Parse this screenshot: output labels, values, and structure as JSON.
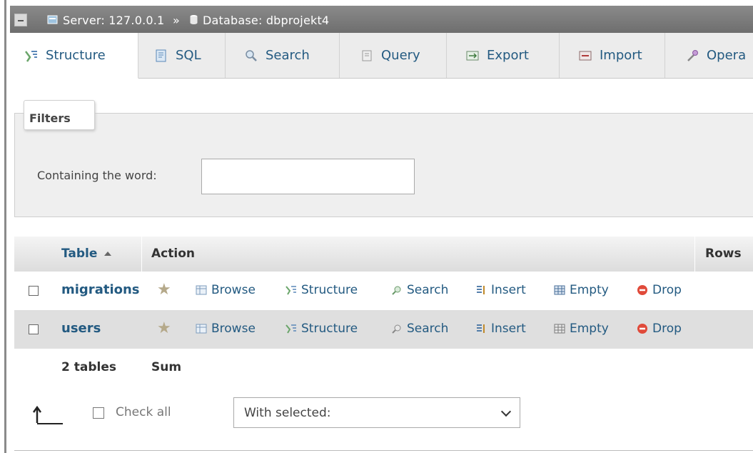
{
  "breadcrumb": {
    "server": "Server: 127.0.0.1",
    "separator": "»",
    "database": "Database: dbprojekt4"
  },
  "tabs": [
    {
      "label": "Structure",
      "icon": "structure-icon",
      "active": true
    },
    {
      "label": "SQL",
      "icon": "sql-icon"
    },
    {
      "label": "Search",
      "icon": "search-icon"
    },
    {
      "label": "Query",
      "icon": "query-icon"
    },
    {
      "label": "Export",
      "icon": "export-icon"
    },
    {
      "label": "Import",
      "icon": "import-icon"
    },
    {
      "label": "Opera",
      "icon": "wrench-icon"
    }
  ],
  "filters": {
    "legend": "Filters",
    "label": "Containing the word:",
    "value": ""
  },
  "table": {
    "headers": {
      "table": "Table",
      "action": "Action",
      "rows": "Rows"
    },
    "actions": [
      "Browse",
      "Structure",
      "Search",
      "Insert",
      "Empty",
      "Drop"
    ],
    "rows": [
      {
        "name": "migrations"
      },
      {
        "name": "users"
      }
    ],
    "footer": {
      "count": "2 tables",
      "sum": "Sum"
    }
  },
  "bulk": {
    "check_all": "Check all",
    "with_selected": "With selected:"
  },
  "colors": {
    "link": "#235a81",
    "header_bar": "#7a7a7a",
    "drop": "#e04a3a"
  }
}
